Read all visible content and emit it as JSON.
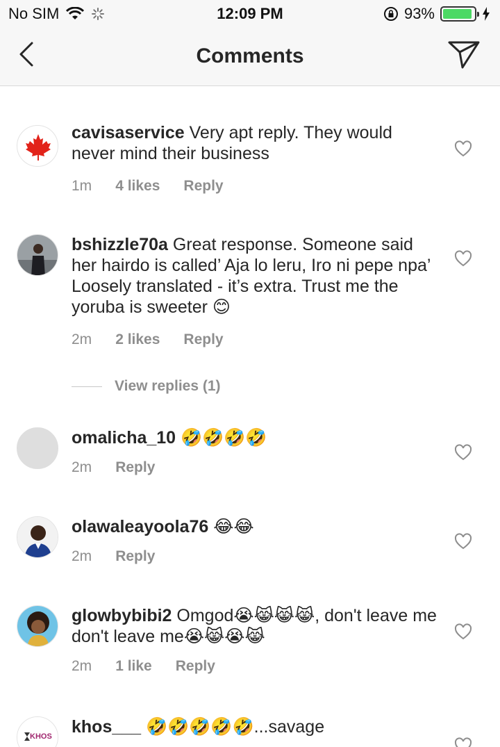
{
  "status_bar": {
    "carrier": "No SIM",
    "time": "12:09 PM",
    "battery_percent": "93%",
    "battery_level": 0.93
  },
  "nav": {
    "title": "Comments",
    "back_icon": "chevron-left-icon",
    "share_icon": "paper-plane-icon"
  },
  "comments": [
    {
      "username": "cavisaservice",
      "text": "Very apt reply. They would never mind their business",
      "time": "1m",
      "likes": "4 likes",
      "reply": "Reply"
    },
    {
      "username": "bshizzle70a",
      "text": "Great response. Someone said her hairdo is called’ Aja lo leru, Iro ni pepe npa’ Loosely translated - it’s extra. Trust me the yoruba is sweeter 😊",
      "time": "2m",
      "likes": "2 likes",
      "reply": "Reply",
      "view_replies": "View replies (1)"
    },
    {
      "username": "omalicha_10",
      "text": "🤣🤣🤣🤣",
      "time": "2m",
      "reply": "Reply"
    },
    {
      "username": "olawaleayoola76",
      "text": "😂😂",
      "time": "2m",
      "reply": "Reply"
    },
    {
      "username": "glowbybibi2",
      "text": "Omgod😭😹😹😹, don't leave me don't leave me😭😹😭😹",
      "time": "2m",
      "likes": "1 like",
      "reply": "Reply"
    },
    {
      "username": "khos___",
      "text": "🤣🤣🤣🤣🤣...savage",
      "avatar_text": "KHOS"
    }
  ],
  "colors": {
    "text": "#262626",
    "meta": "#8e8e8e",
    "bar_bg": "#f7f7f7",
    "battery_green": "#4cd964"
  }
}
